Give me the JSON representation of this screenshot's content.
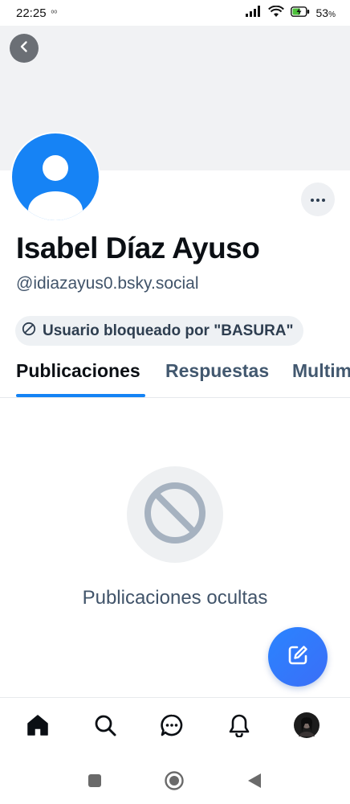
{
  "status_bar": {
    "time": "22:25",
    "extra": "ᵒᵒ",
    "battery_percent": "53",
    "battery_unit": "%"
  },
  "profile": {
    "display_name": "Isabel Díaz Ayuso",
    "handle": "@idiazayus0.bsky.social",
    "blocked_label": "Usuario bloqueado por \"BASURA\""
  },
  "tabs": [
    {
      "label": "Publicaciones",
      "active": true
    },
    {
      "label": "Respuestas",
      "active": false
    },
    {
      "label": "Multimedia",
      "active": false
    }
  ],
  "empty_state": {
    "text": "Publicaciones ocultas"
  },
  "icons": {
    "back": "chevron-left-icon",
    "more": "ellipsis-icon",
    "blocked": "prohibited-icon",
    "compose": "compose-icon",
    "nav": [
      "home-icon",
      "search-icon",
      "chat-icon",
      "bell-icon",
      "avatar"
    ]
  },
  "colors": {
    "accent": "#1483f5",
    "avatar_bg": "#1683f5",
    "fab": "#2f7bf8"
  }
}
